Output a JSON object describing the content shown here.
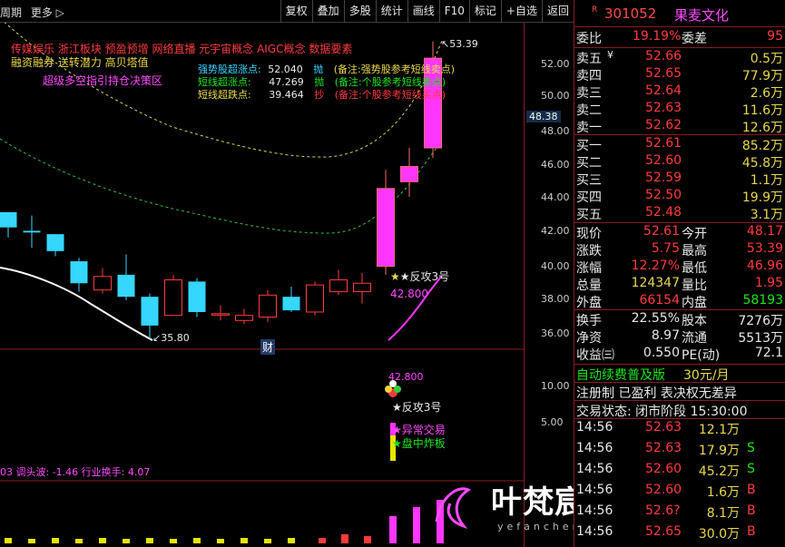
{
  "toolbar": {
    "left": [
      "周期",
      "更多 ▷"
    ],
    "buttons": [
      "复权",
      "叠加",
      "多股",
      "统计",
      "画线",
      "F10",
      "标记",
      "+自选",
      "返回"
    ]
  },
  "chart_overlay": {
    "concepts_line1": "传媒娱乐  浙江板块  预盈预增 网络直播 元宇宙概念 AIGC概念 数据要素",
    "concepts_line2": "融资融券 送转潜力 高贝塔值",
    "strategy_label": "超级多空指引持仓决策区",
    "signals": [
      {
        "name": "强势股超涨点:",
        "value": "52.040",
        "action": "抛",
        "note": "(备注:强势股参考短线卖点)"
      },
      {
        "name": "短线超涨点:",
        "value": "47.269",
        "action": "抛",
        "note": "(备注:个股参考短线卖点)"
      },
      {
        "name": "短线超跌点:",
        "value": "39.464",
        "action": "抄",
        "note": "(备注:个股参考短线买点)"
      }
    ],
    "high_marker": "53.39",
    "low_marker": "35.80",
    "current_price_tag": "48.38",
    "fangong_label": "★反攻3号",
    "fangong_value": "42.800",
    "cai_label": "财",
    "sub_value": "42.800",
    "sub_fangong": "★反攻3号",
    "sub_yichang": "★异常交易",
    "sub_panzhong": "★盘中炸板",
    "bottom_indicator": "03 调头波: -1.46 行业换手: 4.07"
  },
  "axis": {
    "main_ticks": [
      "52.00",
      "50.00",
      "48.00",
      "46.00",
      "44.00",
      "42.00",
      "40.00",
      "38.00",
      "36.00"
    ],
    "sub_ticks": [
      "10.00",
      "5.00"
    ]
  },
  "chart_data": {
    "type": "candlestick",
    "candles": [
      {
        "o": 43.3,
        "c": 42.4,
        "h": 43.3,
        "l": 41.8
      },
      {
        "o": 42.2,
        "c": 42.1,
        "h": 43.1,
        "l": 41.2
      },
      {
        "o": 42.0,
        "c": 41.0,
        "h": 42.0,
        "l": 40.7
      },
      {
        "o": 40.4,
        "c": 39.1,
        "h": 40.6,
        "l": 38.6
      },
      {
        "o": 38.7,
        "c": 39.5,
        "h": 40.0,
        "l": 38.5
      },
      {
        "o": 39.6,
        "c": 38.3,
        "h": 40.8,
        "l": 38.1
      },
      {
        "o": 38.3,
        "c": 36.6,
        "h": 38.5,
        "l": 35.8
      },
      {
        "o": 37.2,
        "c": 39.3,
        "h": 39.6,
        "l": 37.2
      },
      {
        "o": 39.2,
        "c": 37.4,
        "h": 39.4,
        "l": 37.1
      },
      {
        "o": 37.3,
        "c": 37.3,
        "h": 37.8,
        "l": 36.9
      },
      {
        "o": 36.9,
        "c": 37.2,
        "h": 37.6,
        "l": 36.7
      },
      {
        "o": 37.1,
        "c": 38.4,
        "h": 38.7,
        "l": 36.8
      },
      {
        "o": 38.3,
        "c": 37.5,
        "h": 38.9,
        "l": 37.4
      },
      {
        "o": 37.4,
        "c": 39.0,
        "h": 39.2,
        "l": 37.2
      },
      {
        "o": 38.6,
        "c": 39.3,
        "h": 39.9,
        "l": 38.4
      },
      {
        "o": 38.6,
        "c": 39.1,
        "h": 39.7,
        "l": 37.9
      },
      {
        "o": 40.1,
        "c": 44.7,
        "h": 45.8,
        "l": 39.6
      },
      {
        "o": 45.1,
        "c": 46.0,
        "h": 47.1,
        "l": 44.2
      },
      {
        "o": 47.1,
        "c": 52.4,
        "h": 53.39,
        "l": 46.5
      }
    ],
    "ylim": [
      35.2,
      54.5
    ]
  },
  "panel": {
    "r_badge": "R",
    "code": "301052",
    "name": "果麦文化",
    "weibi": {
      "label": "委比",
      "value": "19.19%",
      "label2": "委差",
      "value2": "95"
    },
    "asks": [
      {
        "label": "卖五",
        "price": "52.66",
        "vol": "0.5万",
        "mark": "¥"
      },
      {
        "label": "卖四",
        "price": "52.65",
        "vol": "77.9万",
        "mark": ""
      },
      {
        "label": "卖三",
        "price": "52.64",
        "vol": "2.6万",
        "mark": ""
      },
      {
        "label": "卖二",
        "price": "52.63",
        "vol": "11.6万",
        "mark": ""
      },
      {
        "label": "卖一",
        "price": "52.62",
        "vol": "12.6万",
        "mark": ""
      }
    ],
    "bids": [
      {
        "label": "买一",
        "price": "52.61",
        "vol": "85.2万"
      },
      {
        "label": "买二",
        "price": "52.60",
        "vol": "45.8万"
      },
      {
        "label": "买三",
        "price": "52.59",
        "vol": "1.1万"
      },
      {
        "label": "买四",
        "price": "52.50",
        "vol": "19.9万"
      },
      {
        "label": "买五",
        "price": "52.48",
        "vol": "3.1万"
      }
    ],
    "quote": [
      {
        "l1": "现价",
        "v1": "52.61",
        "c1": "red",
        "l2": "今开",
        "v2": "48.17",
        "c2": "red"
      },
      {
        "l1": "涨跌",
        "v1": "5.75",
        "c1": "red",
        "l2": "最高",
        "v2": "53.39",
        "c2": "red"
      },
      {
        "l1": "涨幅",
        "v1": "12.27%",
        "c1": "red",
        "l2": "最低",
        "v2": "46.96",
        "c2": "red"
      },
      {
        "l1": "总量",
        "v1": "124347",
        "c1": "yellow",
        "l2": "量比",
        "v2": "1.95",
        "c2": "red"
      },
      {
        "l1": "外盘",
        "v1": "66154",
        "c1": "red",
        "l2": "内盘",
        "v2": "58193",
        "c2": "green"
      }
    ],
    "stats": [
      {
        "l1": "换手",
        "v1": "22.55%",
        "l2": "股本",
        "v2": "7276万"
      },
      {
        "l1": "净资",
        "v1": "8.97",
        "l2": "流通",
        "v2": "5513万"
      },
      {
        "l1": "收益㈢",
        "v1": "0.550",
        "l2": "PE(动)",
        "v2": "72.1"
      }
    ],
    "promo": "自动续费普及版",
    "promo_price": "30元/月",
    "register": "注册制 已盈利 表决权无差异",
    "trade_status": "交易状态: 闭市阶段 15:30:00",
    "ticks": [
      {
        "time": "14:56",
        "price": "52.63",
        "vol": "12.1万",
        "side": ""
      },
      {
        "time": "14:56",
        "price": "52.63",
        "vol": "17.9万",
        "side": "S"
      },
      {
        "time": "14:56",
        "price": "52.60",
        "vol": "45.2万",
        "side": "S"
      },
      {
        "time": "14:56",
        "price": "52.60",
        "vol": "1.6万",
        "side": "B"
      },
      {
        "time": "14:56",
        "price": "52.6?",
        "vol": "8.1万",
        "side": "B"
      },
      {
        "time": "14:56",
        "price": "52.65",
        "vol": "30.0万",
        "side": "B"
      }
    ]
  },
  "watermark": {
    "title": "叶梵宸指标公式网",
    "url": "yefanchen.com"
  }
}
